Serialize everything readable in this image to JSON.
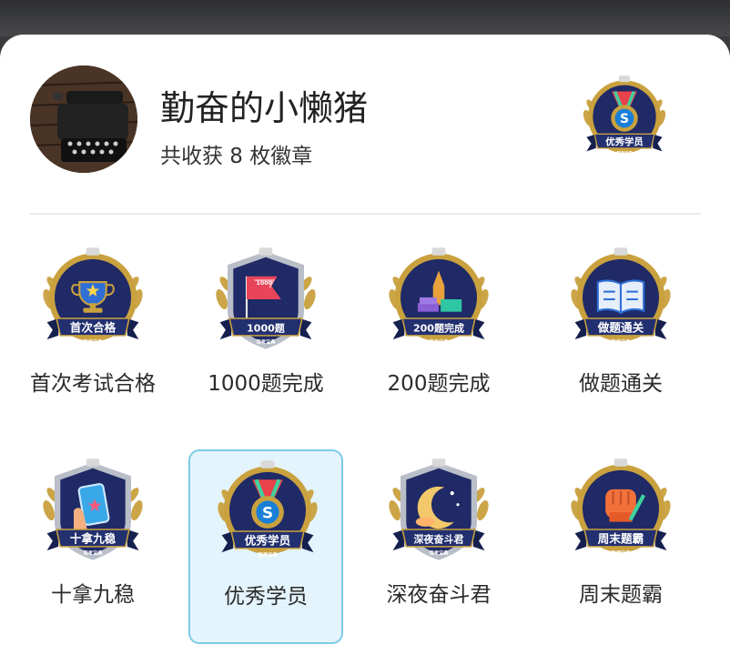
{
  "profile": {
    "username": "勤奋的小懒猪",
    "badge_count_text": "共收获 8 枚徽章",
    "current_badge": {
      "ribbon": "优秀学员",
      "icon": "medal-s-icon"
    }
  },
  "badge_brand": "驾考宝典",
  "badges": [
    {
      "ribbon": "首次合格",
      "label": "首次考试合格",
      "icon": "trophy-icon",
      "selected": false
    },
    {
      "ribbon": "1000题",
      "label": "1000题完成",
      "icon": "flag-icon",
      "flag_text": "1000",
      "selected": false
    },
    {
      "ribbon": "200题完成",
      "label": "200题完成",
      "icon": "pen-books-icon",
      "selected": false
    },
    {
      "ribbon": "做题通关",
      "label": "做题通关",
      "icon": "open-book-icon",
      "selected": false
    },
    {
      "ribbon": "十拿九稳",
      "label": "十拿九稳",
      "icon": "hand-phone-icon",
      "selected": false
    },
    {
      "ribbon": "优秀学员",
      "label": "优秀学员",
      "icon": "medal-s-icon",
      "selected": true
    },
    {
      "ribbon": "深夜奋斗君",
      "label": "深夜奋斗君",
      "icon": "moon-icon",
      "selected": false
    },
    {
      "ribbon": "周末题霸",
      "label": "周末题霸",
      "icon": "fist-icon",
      "selected": false
    }
  ],
  "colors": {
    "navy": "#1f2a66",
    "gold": "#c9a13e",
    "selection_bg": "#e4f4fc",
    "selection_border": "#7ccbe6"
  }
}
